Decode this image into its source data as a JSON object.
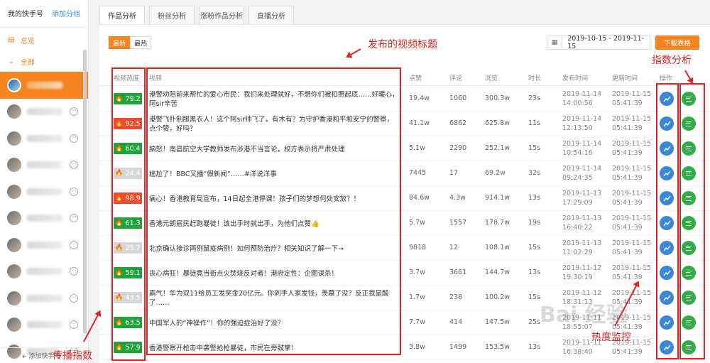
{
  "sidebar": {
    "title": "我的快手号",
    "add_group": "添加分组",
    "overview": "总览",
    "all": "全部",
    "footer": "+ 添加快手号"
  },
  "tabs": [
    "作品分析",
    "粉丝分析",
    "涨粉作品分析",
    "直播分析"
  ],
  "toolbar": {
    "sort_latest": "最新",
    "sort_hot": "最热",
    "date_range": "2019-10-15 - 2019-11-15",
    "download": "下载表格"
  },
  "columns": [
    "视频热度",
    "视频",
    "点赞",
    "评论",
    "浏览",
    "时长",
    "发布时间",
    "更新时间",
    "操作"
  ],
  "rows": [
    {
      "heat": "79.2",
      "level": "green",
      "title": "港警劝阻前来帮忙的爱心市民：我们来处理就好，不想你们被扣照起底……好暖心，阿sir辛苦",
      "likes": "19.4w",
      "comments": "1060",
      "views": "300.3w",
      "duration": "23s",
      "pub_date": "2019-11-14",
      "pub_time": "14:00:56",
      "upd_date": "2019-11-15",
      "upd_time": "05:41:39"
    },
    {
      "heat": "92.5",
      "level": "red",
      "title": "港警飞扑制服黑衣人！这个阿sir帅飞了，有木有？为守护香港和平和安宁的警察，点个赞，好吗？",
      "likes": "41.1w",
      "comments": "6862",
      "views": "625.8w",
      "duration": "11s",
      "pub_date": "2019-11-14",
      "pub_time": "12:13:50",
      "upd_date": "2019-11-15",
      "upd_time": "05:41:39"
    },
    {
      "heat": "60.4",
      "level": "green",
      "title": "脑怒！南昌航空大学教师发布涉港不当言论，校方表示将严肃处理",
      "likes": "5.1w",
      "comments": "2290",
      "views": "252.1w",
      "duration": "15s",
      "pub_date": "2019-11-14",
      "pub_time": "10:54:16",
      "upd_date": "2019-11-15",
      "upd_time": "05:41:39"
    },
    {
      "heat": "24.4",
      "level": "gray",
      "title": "尴尬了！BBC又播“假新闻”……#洋说洋事",
      "likes": "7445",
      "comments": "17",
      "views": "69.2w",
      "duration": "32s",
      "pub_date": "2019-11-14",
      "pub_time": "09:24:35",
      "upd_date": "2019-11-15",
      "upd_time": "05:41:39"
    },
    {
      "heat": "98.9",
      "level": "red",
      "title": "痛心！香港教育局宣布，14日起全港停课！孩子们的梦想何处安放？！",
      "likes": "84.6w",
      "comments": "4.3w",
      "views": "914.1w",
      "duration": "13s",
      "pub_date": "2019-11-13",
      "pub_time": "17:29:09",
      "upd_date": "2019-11-15",
      "upd_time": "05:41:39"
    },
    {
      "heat": "61.3",
      "level": "green",
      "title": "香港元朗居民赶跑暴徒！该出手时就出手，为他们点赞👍",
      "likes": "5.7w",
      "comments": "1557",
      "views": "178.7w",
      "duration": "19s",
      "pub_date": "2019-11-13",
      "pub_time": "16:40:22",
      "upd_date": "2019-11-15",
      "upd_time": "05:41:39"
    },
    {
      "heat": "25.7",
      "level": "gray",
      "title": "北京确认接诊两例鼠疫病例！如何预防治疗？相关知识了解一下→",
      "likes": "9818",
      "comments": "12",
      "views": "108.1w",
      "duration": "15s",
      "pub_date": "2019-11-13",
      "pub_time": "11:02:29",
      "upd_date": "2019-11-15",
      "upd_time": "05:41:39"
    },
    {
      "heat": "59.1",
      "level": "green",
      "title": "丧心病狂！暴徒竟当街点火焚烧反对者！港府定性：企图谋杀！",
      "likes": "3.7w",
      "comments": "3661",
      "views": "144.7w",
      "duration": "13s",
      "pub_date": "2019-11-12",
      "pub_time": "19:30:19",
      "upd_date": "2019-11-15",
      "upd_time": "05:41:39"
    },
    {
      "heat": "43.5",
      "level": "gray",
      "title": "霸气！华为双11给员工发奖金20亿元。你剁手人家发钱，羡慕了没？反正我是酸了……",
      "likes": "1.7w",
      "comments": "238",
      "views": "100.2w",
      "duration": "15s",
      "pub_date": "2019-11-12",
      "pub_time": "18:31:13",
      "upd_date": "2019-11-15",
      "upd_time": "05:41:39"
    },
    {
      "heat": "63.5",
      "level": "green",
      "title": "中国军人的“神操作”！你的强迫症治好了没？",
      "likes": "7.7w",
      "comments": "414",
      "views": "147.5w",
      "duration": "25s",
      "pub_date": "2019-11-11",
      "pub_time": "18:55:07",
      "upd_date": "2019-11-15",
      "upd_time": "05:41:39"
    },
    {
      "heat": "57.9",
      "level": "green",
      "title": "香港警察开枪击中袭警抢枪暴徒，市民在旁鼓掌！",
      "likes": "3.8w",
      "comments": "1499",
      "views": "153.5w",
      "duration": "13s",
      "pub_date": "2019-11-11",
      "pub_time": "16:38:40",
      "upd_date": "2019-11-15",
      "upd_time": "05:41:39"
    }
  ],
  "annotations": {
    "title_label": "发布的视频标题",
    "index_label": "指数分析",
    "spread_label": "传播指数",
    "monitor_label": "热度监控"
  },
  "watermark": "Bai 经验",
  "colors": {
    "accent": "#f5841f",
    "hot_green": "#1ea53a",
    "hot_red": "#ef4a2a",
    "hot_gray": "#d6d6d6",
    "annotation": "#e02424"
  }
}
